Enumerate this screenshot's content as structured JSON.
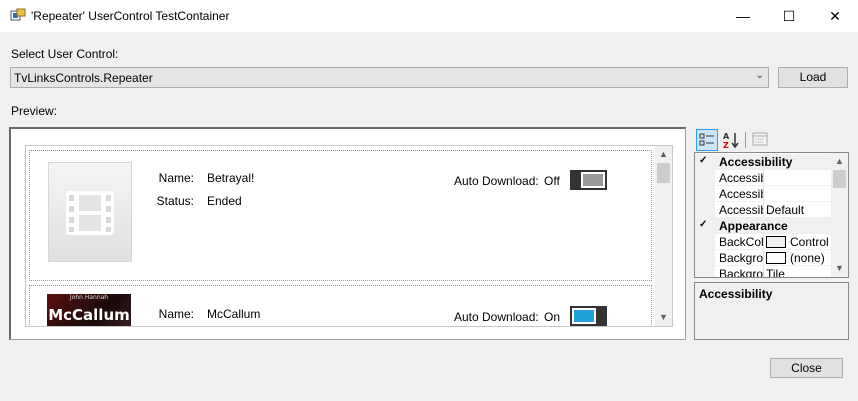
{
  "window": {
    "title": "'Repeater' UserControl TestContainer",
    "controls": {
      "minimize": "—",
      "maximize": "☐",
      "close": "✕"
    }
  },
  "selector": {
    "label": "Select User Control:",
    "value": "TvLinksControls.Repeater",
    "load_label": "Load"
  },
  "preview": {
    "label": "Preview:",
    "items": [
      {
        "name_label": "Name:",
        "name": "Betrayal!",
        "status_label": "Status:",
        "status": "Ended",
        "auto_download_label": "Auto Download:",
        "auto_download_state": "Off",
        "thumbnail": "film-placeholder-icon"
      },
      {
        "name_label": "Name:",
        "name": "McCallum",
        "auto_download_label": "Auto Download:",
        "auto_download_state": "On",
        "thumbnail_title": "McCallum",
        "thumbnail_sub": "John Hannah"
      }
    ]
  },
  "property_grid": {
    "toolbar": [
      "categorized-icon",
      "alphabetical-icon",
      "property-pages-icon"
    ],
    "rows": [
      {
        "type": "category",
        "name": "Accessibility"
      },
      {
        "type": "property",
        "name": "Accessibi",
        "value": ""
      },
      {
        "type": "property",
        "name": "Accessibi",
        "value": ""
      },
      {
        "type": "property",
        "name": "Accessibi",
        "value": "Default"
      },
      {
        "type": "category",
        "name": "Appearance"
      },
      {
        "type": "property",
        "name": "BackColo",
        "value": "Control",
        "swatch": true
      },
      {
        "type": "property",
        "name": "Backgrou",
        "value": "(none)",
        "swatch": true
      },
      {
        "type": "property",
        "name": "Backgrou",
        "value": "Tile"
      }
    ],
    "description_title": "Accessibility"
  },
  "footer": {
    "close_label": "Close"
  },
  "colors": {
    "toggle_on": "#1fa1d9",
    "toggle_off": "#999999"
  }
}
